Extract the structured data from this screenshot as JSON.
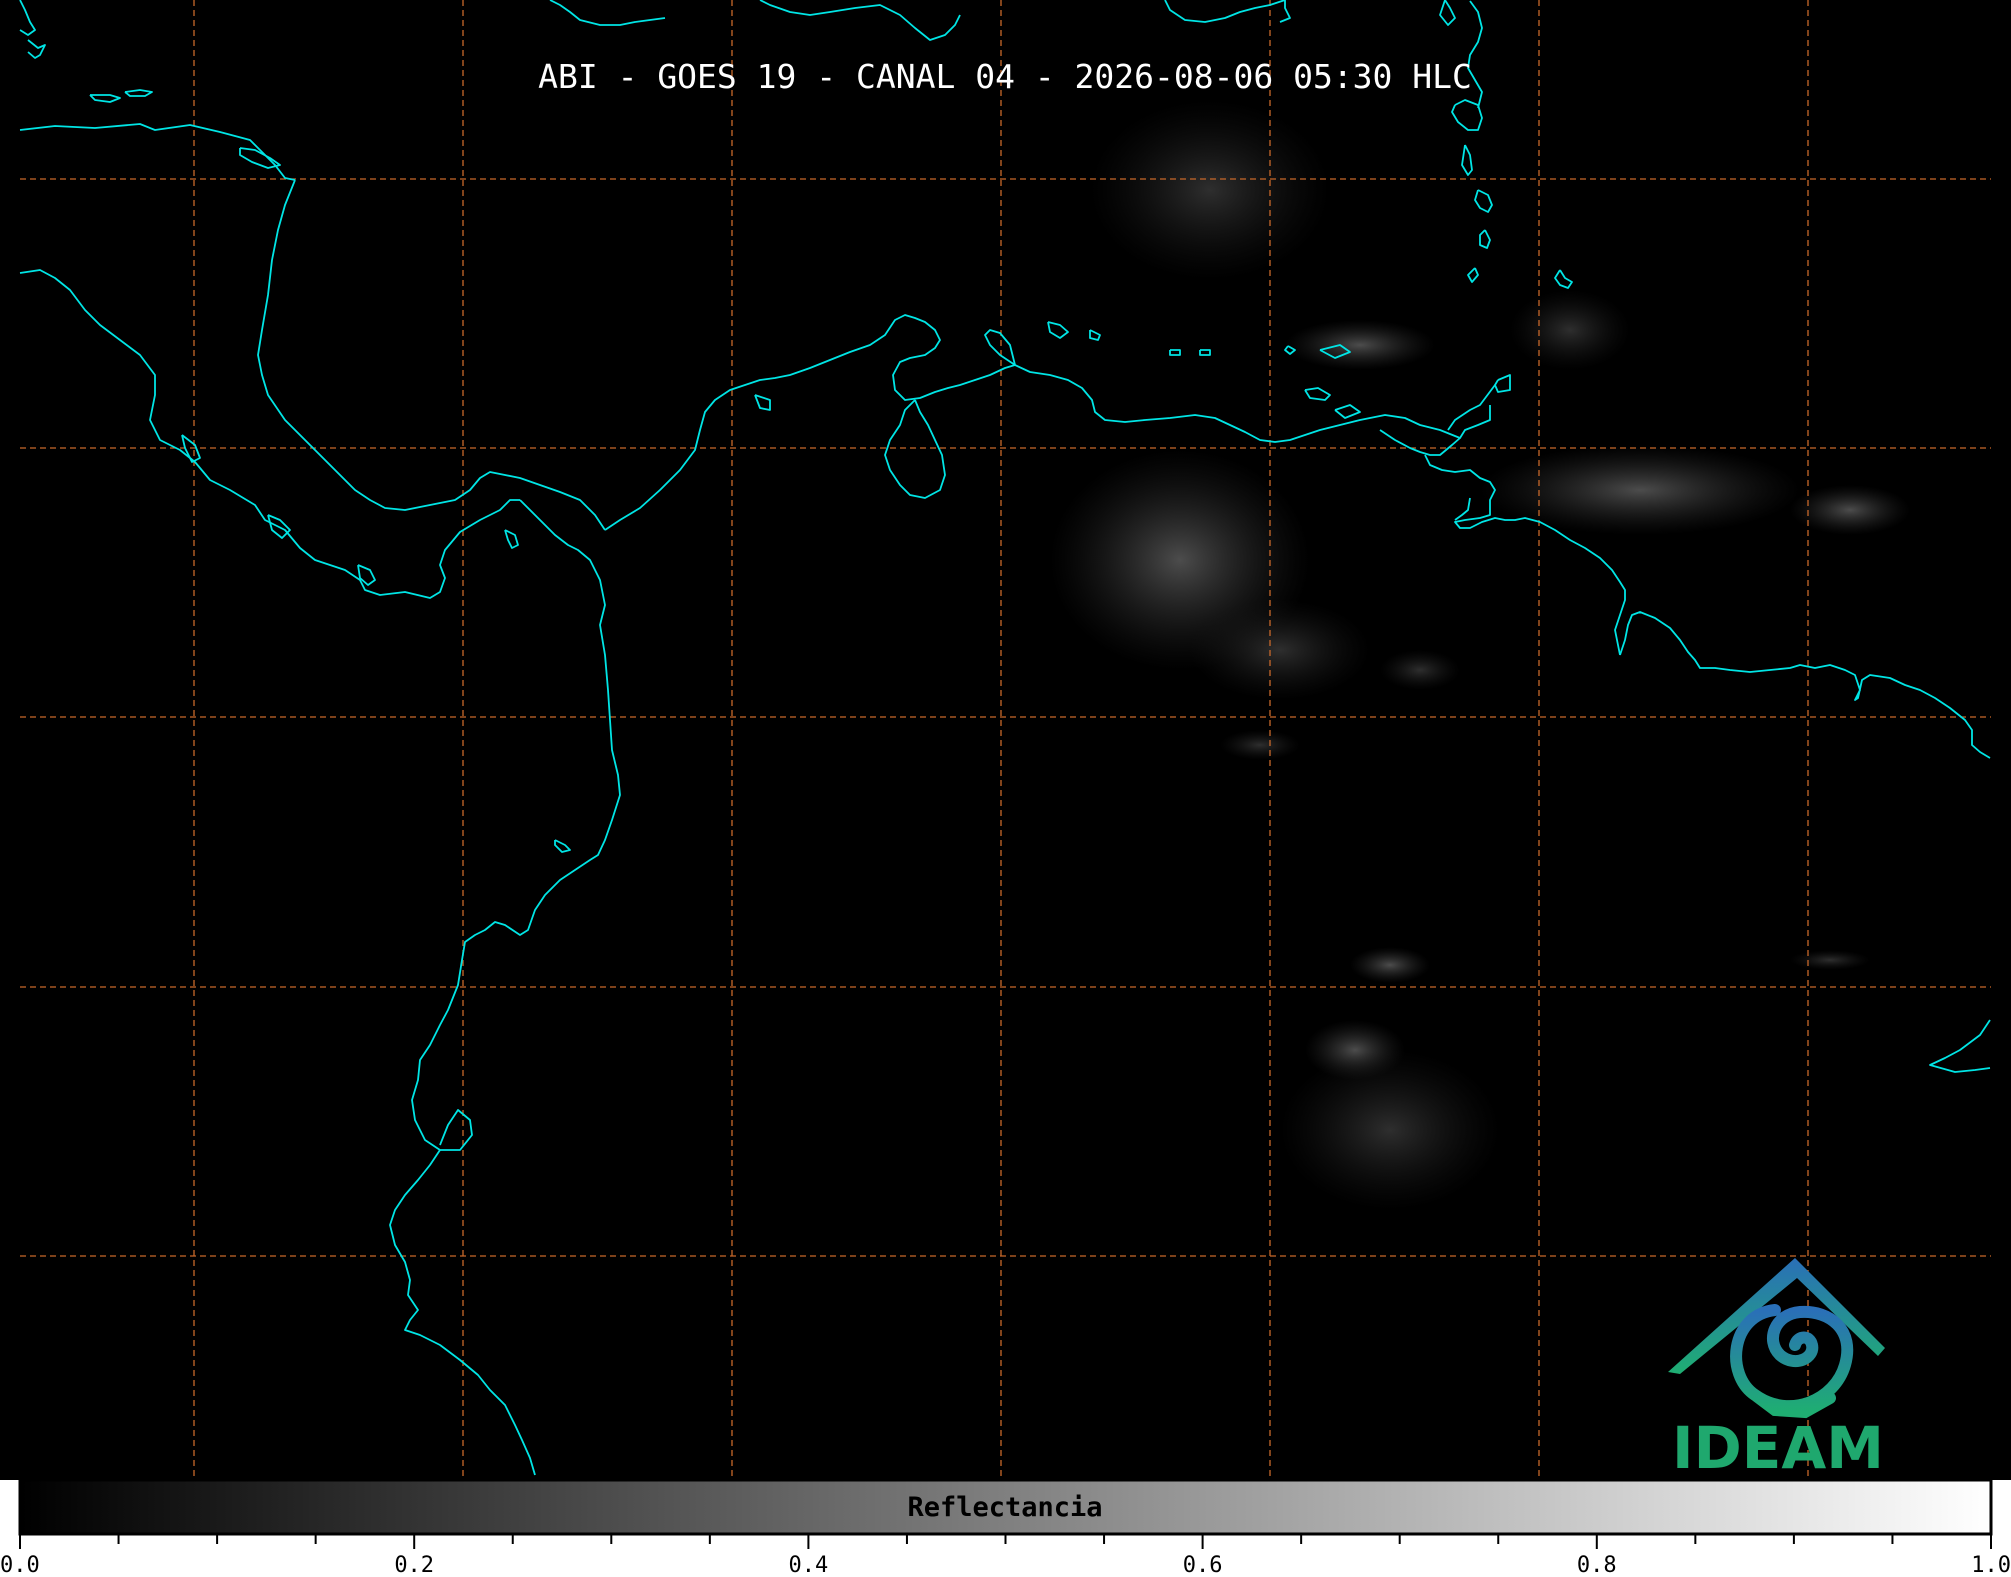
{
  "title": "ABI - GOES 19 - CANAL 04 - 2026-08-06 05:30 HLC",
  "colorbar": {
    "label": "Reflectancia",
    "range": [
      0.0,
      1.0
    ],
    "colormap": "grayscale (black to white)",
    "tick_labels": [
      "0.0",
      "0.2",
      "0.4",
      "0.6",
      "0.8",
      "1.0"
    ]
  },
  "logo": {
    "text": "IDEAM",
    "color": "#1fa86e",
    "accent": "#1f73b4"
  },
  "colors": {
    "background": "#000000",
    "coastline": "#00e5e5",
    "gridlines": "#c8682a"
  },
  "gridlines": {
    "style": "dashed"
  }
}
